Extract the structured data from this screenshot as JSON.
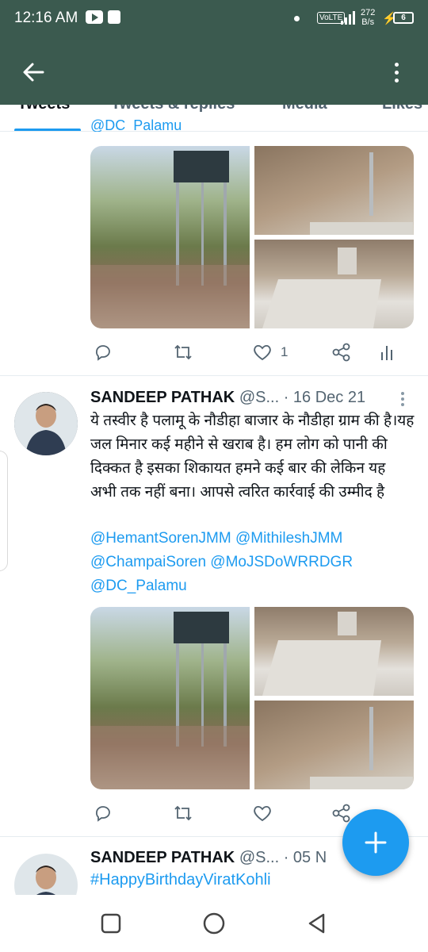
{
  "status_bar": {
    "time": "12:16 AM",
    "network": "VoLTE",
    "speed_value": "272",
    "speed_unit": "B/s",
    "battery": "6"
  },
  "app_bar": {
    "back_icon": "arrow-left-icon",
    "menu_icon": "more-vertical-icon"
  },
  "tabs": [
    {
      "label": "Tweets",
      "active": true
    },
    {
      "label": "Tweets & replies",
      "active": false
    },
    {
      "label": "Media",
      "active": false
    },
    {
      "label": "Likes",
      "active": false
    }
  ],
  "tweet1": {
    "partial_mention": "@DC_Palamu",
    "actions": {
      "like_count": "1"
    }
  },
  "tweet2": {
    "name": "SANDEEP PATHAK",
    "handle": "@S...",
    "date": "· 16 Dec 21",
    "text": "ये तस्वीर है पलामू के नौडीहा बाजार के नौडीहा ग्राम की है।यह जल मिनार कई महीने से खराब है। हम लोग को पानी की दिक्कत है इसका शिकायत हमने कई बार की लेकिन यह अभी तक नहीं बना। आपसे त्वरित कार्रवाई की उम्मीद है",
    "mention_line1": "@HemantSorenJMM @MithileshJMM",
    "mention_line2": "@ChampaiSoren @MoJSDoWRRDGR",
    "mention_line3": "@DC_Palamu"
  },
  "tweet3": {
    "name": "SANDEEP PATHAK",
    "handle": "@S...",
    "date": "· 05 N",
    "hashtag": "#HappyBirthdayViratKohli"
  },
  "colors": {
    "app_bar": "#3b5a4f",
    "accent": "#1d9bf0",
    "secondary_text": "#536471"
  },
  "icons": [
    "reply-icon",
    "retweet-icon",
    "like-icon",
    "share-icon",
    "analytics-icon",
    "compose-plus-icon"
  ],
  "nav_bar": [
    "recents-square-icon",
    "home-circle-icon",
    "back-triangle-icon"
  ]
}
